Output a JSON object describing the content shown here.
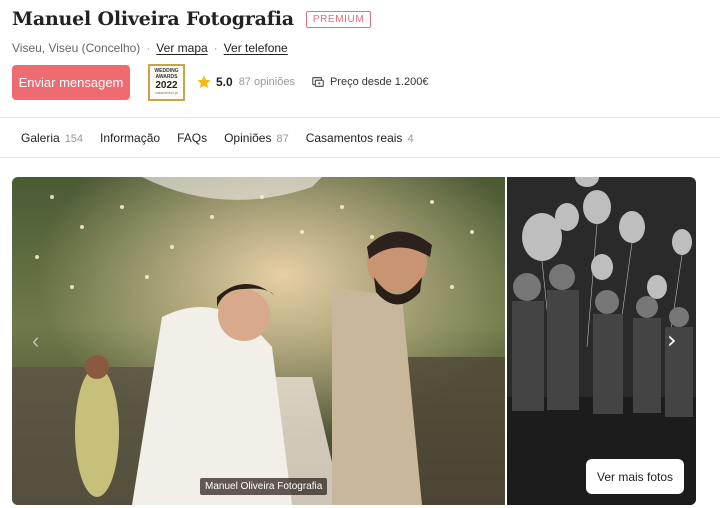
{
  "vendor": {
    "name": "Manuel Oliveira Fotografia",
    "badge": "PREMIUM",
    "location": "Viseu, Viseu (Concelho)",
    "map_link": "Ver mapa",
    "phone_link": "Ver telefone"
  },
  "actions": {
    "message_button": "Enviar mensagem",
    "award": {
      "line1": "WEDDING",
      "line2": "AWARDS",
      "year": "2022",
      "site": "casamentos.pt"
    },
    "rating": "5.0",
    "reviews": "87 opiniões",
    "price": "Preço desde 1.200€"
  },
  "tabs": [
    {
      "label": "Galeria",
      "count": "154"
    },
    {
      "label": "Informação",
      "count": ""
    },
    {
      "label": "FAQs",
      "count": ""
    },
    {
      "label": "Opiniões",
      "count": "87"
    },
    {
      "label": "Casamentos reais",
      "count": "4"
    }
  ],
  "gallery": {
    "caption": "Manuel Oliveira Fotografia",
    "more_button": "Ver mais fotos",
    "prev_icon": "chevron-left-icon",
    "next_icon": "chevron-right-icon"
  },
  "colors": {
    "accent": "#ef6b72",
    "premium": "#e0707a",
    "award_gold": "#c9a44a",
    "star": "#f5b915"
  }
}
